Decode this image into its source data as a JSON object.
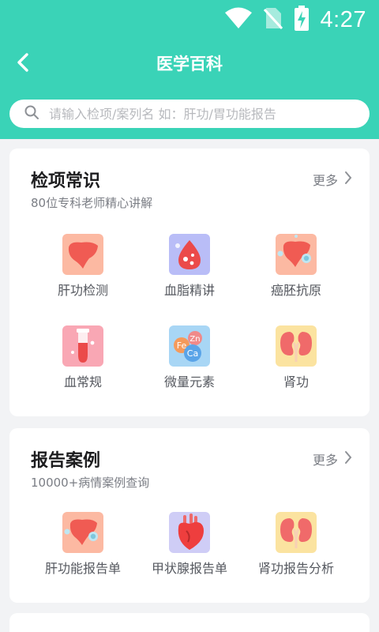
{
  "status_bar": {
    "time": "4:27",
    "icons": [
      "wifi-icon",
      "no-sim-icon",
      "battery-charging-icon"
    ]
  },
  "nav": {
    "title": "医学百科",
    "back_icon": "back-arrow-icon"
  },
  "search": {
    "placeholder": "请输入检项/案列名 如：肝功/胃功能报告",
    "value": ""
  },
  "colors": {
    "header": "#3ad3b7",
    "background": "#f2f3f5",
    "card": "#ffffff"
  },
  "section1": {
    "title": "检项常识",
    "subtitle": "80位专科老师精心讲解",
    "more_label": "更多",
    "items": [
      {
        "label": "肝功检测",
        "icon": "liver-icon"
      },
      {
        "label": "血脂精讲",
        "icon": "blood-drop-icon"
      },
      {
        "label": "癌胚抗原",
        "icon": "liver-virus-icon"
      },
      {
        "label": "血常规",
        "icon": "test-tube-icon"
      },
      {
        "label": "微量元素",
        "icon": "trace-elements-icon"
      },
      {
        "label": "肾功",
        "icon": "kidney-icon"
      }
    ]
  },
  "section2": {
    "title": "报告案例",
    "subtitle": "10000+病情案例查询",
    "more_label": "更多",
    "items": [
      {
        "label": "肝功能报告单",
        "icon": "liver-virus-icon"
      },
      {
        "label": "甲状腺报告单",
        "icon": "heart-icon"
      },
      {
        "label": "肾功报告分析",
        "icon": "kidney-icon"
      }
    ]
  },
  "icon_text": {
    "fe": "Fe",
    "zn": "Zn",
    "ca": "Ca"
  }
}
